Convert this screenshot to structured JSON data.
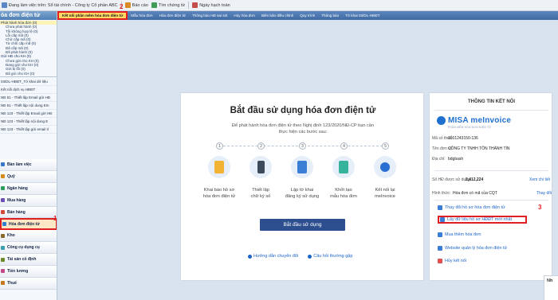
{
  "titlebar": {
    "items": [
      {
        "label": "Đang làm việc trên: Sổ tài chính - Công ty Cổ phần ABC",
        "icon": "database-icon"
      },
      {
        "label": "Báo cáo",
        "icon": "report-icon"
      },
      {
        "label": "Tìm chứng từ",
        "icon": "search-icon"
      },
      {
        "label": "Ngày hạch toán",
        "icon": "calendar-icon"
      }
    ]
  },
  "sidebar": {
    "title": "óa đơn điện tử",
    "tree": [
      {
        "label": "Phát hành hóa đơn (0)",
        "kind": "group"
      },
      {
        "label": "Chưa phát hành (0)",
        "kind": "leaf"
      },
      {
        "label": "Tồi không hợp lệ (0)",
        "kind": "leaf"
      },
      {
        "label": "Lỗi cấp mã (0)",
        "kind": "leaf"
      },
      {
        "label": "Chờ cấp mã (0)",
        "kind": "leaf"
      },
      {
        "label": "Từ chối cấp mã (0)",
        "kind": "leaf"
      },
      {
        "label": "Đã cấp mã (0)",
        "kind": "leaf"
      },
      {
        "label": "Đã phát hành (0)",
        "kind": "leaf"
      },
      {
        "label": "Gửi HĐ cho KH (0)",
        "kind": "group"
      },
      {
        "label": "Chưa gửi cho KH (0)",
        "kind": "leaf"
      },
      {
        "label": "Đang gửi cho KH (0)",
        "kind": "leaf"
      },
      {
        "label": "Gửi bị lỗi (0)",
        "kind": "leaf"
      },
      {
        "label": "Đã gửi cho KH (0)",
        "kind": "leaf"
      }
    ],
    "reports": [
      "03/DL-HĐĐT_Tờ khai dữ liệu",
      "Kết nối dịch vụ HĐĐT",
      "NĐ 51 - Thiết lập Email gửi HĐ",
      "NĐ 51 - Thiết lập nội dung Em",
      "NĐ 123 - Thiết lập Email gửi HĐ",
      "NĐ 123 - Thiết lập nội dung E",
      "NĐ 123 - Thiết lập gửi email tl"
    ],
    "modules": [
      {
        "label": "Bàn làm việc",
        "color": "#3a78c9"
      },
      {
        "label": "Quỹ",
        "color": "#d58a1c"
      },
      {
        "label": "Ngân hàng",
        "color": "#2d9c5e"
      },
      {
        "label": "Mua hàng",
        "color": "#6b4fb5"
      },
      {
        "label": "Bán hàng",
        "color": "#d14a3a"
      },
      {
        "label": "Hóa đơn điện tử",
        "color": "#2f7fd1"
      },
      {
        "label": "Kho",
        "color": "#8a6a2c"
      },
      {
        "label": "Công cụ dụng cụ",
        "color": "#3a9fb0"
      },
      {
        "label": "Tài sản cố định",
        "color": "#6d8a2b"
      },
      {
        "label": "Tiền lương",
        "color": "#c14b8a"
      },
      {
        "label": "Thuế",
        "color": "#c7781f"
      }
    ]
  },
  "tabs": [
    {
      "label": "Kết nối phần mềm hóa đơn điện tử"
    },
    {
      "label": "Mẫu hóa đơn"
    },
    {
      "label": "Hóa đơn điện tử"
    },
    {
      "label": "Thông báo HĐ sai sót"
    },
    {
      "label": "Hủy hóa đơn"
    },
    {
      "label": "Biên bản điều chỉnh"
    },
    {
      "label": "Quy trình"
    },
    {
      "label": "Thông báo"
    },
    {
      "label": "Tờ khai 03/DL-HĐĐT"
    }
  ],
  "card": {
    "title": "Bắt đầu sử dụng hóa đơn điện tử",
    "desc_line1": "Để phát hành hóa đơn điện tử theo Nghị định 123/2020/NĐ-CP bạn cần",
    "desc_line2": "thực hiện các bước sau:",
    "steps": [
      {
        "num": "1",
        "line1": "Khai báo hồ sơ",
        "line2": "hóa đơn điện tử",
        "color": "#f2b233"
      },
      {
        "num": "2",
        "line1": "Thiết lập",
        "line2": "chữ ký số",
        "color": "#3d4a5c"
      },
      {
        "num": "3",
        "line1": "Lập tờ khai",
        "line2": "đăng ký sử dụng",
        "color": "#3a7fd5"
      },
      {
        "num": "4",
        "line1": "Khởi tạo",
        "line2": "mẫu hóa đơn",
        "color": "#36b39a"
      },
      {
        "num": "5",
        "line1": "Kết nối lại",
        "line2": "meInvoice",
        "color": "#2a6fd1"
      }
    ],
    "start_label": "Bắt đầu sử dụng",
    "link_guide": "Hướng dẫn chuyển đổi",
    "link_faq": "Câu hỏi thường gặp"
  },
  "panel": {
    "title": "THÔNG TIN KẾT NỐI",
    "brand": "MISA meInvoice",
    "brand_sub": "PHẦN MỀM HÓA ĐƠN ĐIỆN TỬ",
    "tax_label": "Mã số thuế:",
    "tax_value": "0101243150-136",
    "company_label": "Tên đơn vị:",
    "company_value": "CÔNG TY TNHH TÔN THÀNH TÍN",
    "address_label": "Địa chỉ:",
    "address_value": "bdgbash",
    "qty_label": "Số HĐ được sử dụng:",
    "qty_value": "2,412,224",
    "qty_action": "Xem chi tiết",
    "form_label": "Hình thức:",
    "form_value": "Hóa đơn có mã của CQT",
    "form_action": "Thay đổi",
    "actions": [
      {
        "label": "Thay đổi hồ sơ hóa đơn điện tử",
        "color": "#3a7fd5"
      },
      {
        "label": "Lấy dữ liệu hồ sơ HĐĐT mới nhất",
        "color": "#3a7fd5"
      },
      {
        "label": "Mua thêm hóa đơn",
        "color": "#3a7fd5"
      },
      {
        "label": "Website quản lý hóa đơn điện tử",
        "color": "#3a7fd5"
      },
      {
        "label": "Hủy kết nối",
        "color": "#e05050"
      }
    ]
  },
  "callouts": {
    "one": "1",
    "two": "2",
    "three": "3"
  },
  "corner_text": "Nh"
}
